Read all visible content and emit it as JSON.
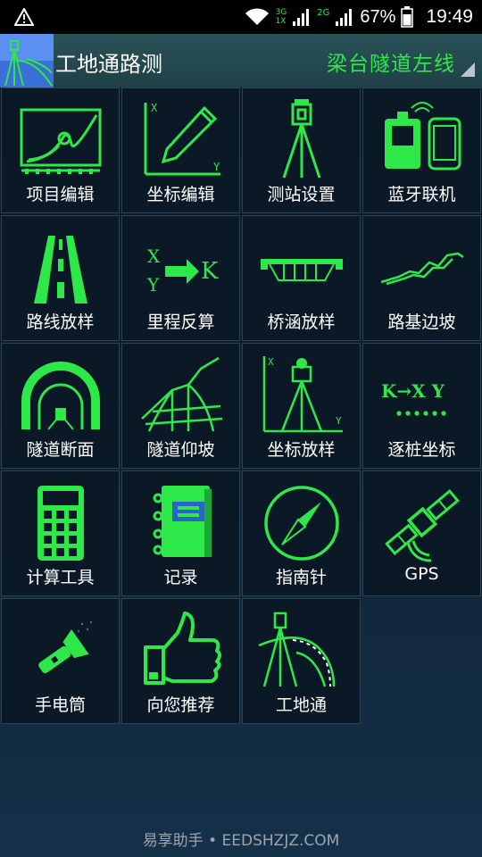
{
  "status_bar": {
    "battery": "67%",
    "time": "19:49",
    "network_top": "3G",
    "network_bottom": "1X",
    "network2": "2G"
  },
  "header": {
    "title": "工地通路测",
    "project": "梁台隧道左线",
    "logo_icon": "survey-logo-icon"
  },
  "tiles": [
    {
      "label": "项目编辑",
      "icon": "project-edit-icon"
    },
    {
      "label": "坐标编辑",
      "icon": "coordinate-edit-icon"
    },
    {
      "label": "测站设置",
      "icon": "station-setup-icon"
    },
    {
      "label": "蓝牙联机",
      "icon": "bluetooth-connect-icon"
    },
    {
      "label": "路线放样",
      "icon": "route-stakeout-icon"
    },
    {
      "label": "里程反算",
      "icon": "mileage-inverse-icon"
    },
    {
      "label": "桥涵放样",
      "icon": "bridge-stakeout-icon"
    },
    {
      "label": "路基边坡",
      "icon": "subgrade-slope-icon"
    },
    {
      "label": "隧道断面",
      "icon": "tunnel-section-icon"
    },
    {
      "label": "隧道仰坡",
      "icon": "tunnel-slope-icon"
    },
    {
      "label": "坐标放样",
      "icon": "coordinate-stakeout-icon"
    },
    {
      "label": "逐桩坐标",
      "icon": "stake-coordinates-icon"
    },
    {
      "label": "计算工具",
      "icon": "calculator-icon"
    },
    {
      "label": "记录",
      "icon": "notebook-icon"
    },
    {
      "label": "指南针",
      "icon": "compass-icon"
    },
    {
      "label": "GPS",
      "icon": "satellite-icon"
    },
    {
      "label": "手电筒",
      "icon": "flashlight-icon"
    },
    {
      "label": "向您推荐",
      "icon": "thumbs-up-icon"
    },
    {
      "label": "工地通",
      "icon": "site-app-icon"
    }
  ],
  "icon_text": {
    "x_axis": "X",
    "y_axis": "Y",
    "k_letter": "K",
    "kxy": "K→X Y"
  },
  "watermark": "易享助手 • EEDSHZJZ.COM",
  "colors": {
    "accent_green": "#2ee84a",
    "tile_border": "#2d4253",
    "header_bg": "#1f4047"
  }
}
